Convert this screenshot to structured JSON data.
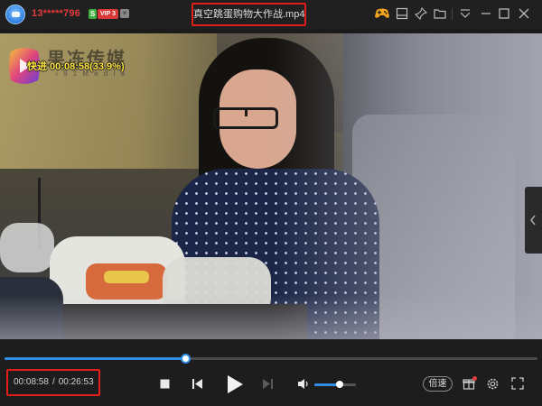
{
  "header": {
    "username": "13*****796",
    "badge_s": "S",
    "badge_vip": "VIP 3",
    "badge_close": "×",
    "file_title": "真空跳蛋购物大作战.mp4"
  },
  "icons": {
    "avatar": "user-avatar-icon",
    "game": "gamepad-icon",
    "panel": "panel-layout-icon",
    "pin": "pin-icon",
    "folder": "folder-icon",
    "menu": "dropdown-menu-icon",
    "minimize": "minimize-icon",
    "maximize": "maximize-icon",
    "close": "close-icon"
  },
  "video": {
    "watermark_name": "果冻传媒",
    "watermark_sub": "i 9 1   M e d i a",
    "seek_osd": "快进 00:08:58(33.9%)"
  },
  "playback": {
    "current_time": "00:08:58",
    "separator": "/",
    "total_time": "00:26:53",
    "progress": 0.339,
    "volume": 0.6,
    "speed_label": "倍速"
  },
  "colors": {
    "accent": "#2e8ee8",
    "highlight_border": "#e31c1c",
    "username": "#e23b3b",
    "osd_text": "#ffe43a"
  }
}
